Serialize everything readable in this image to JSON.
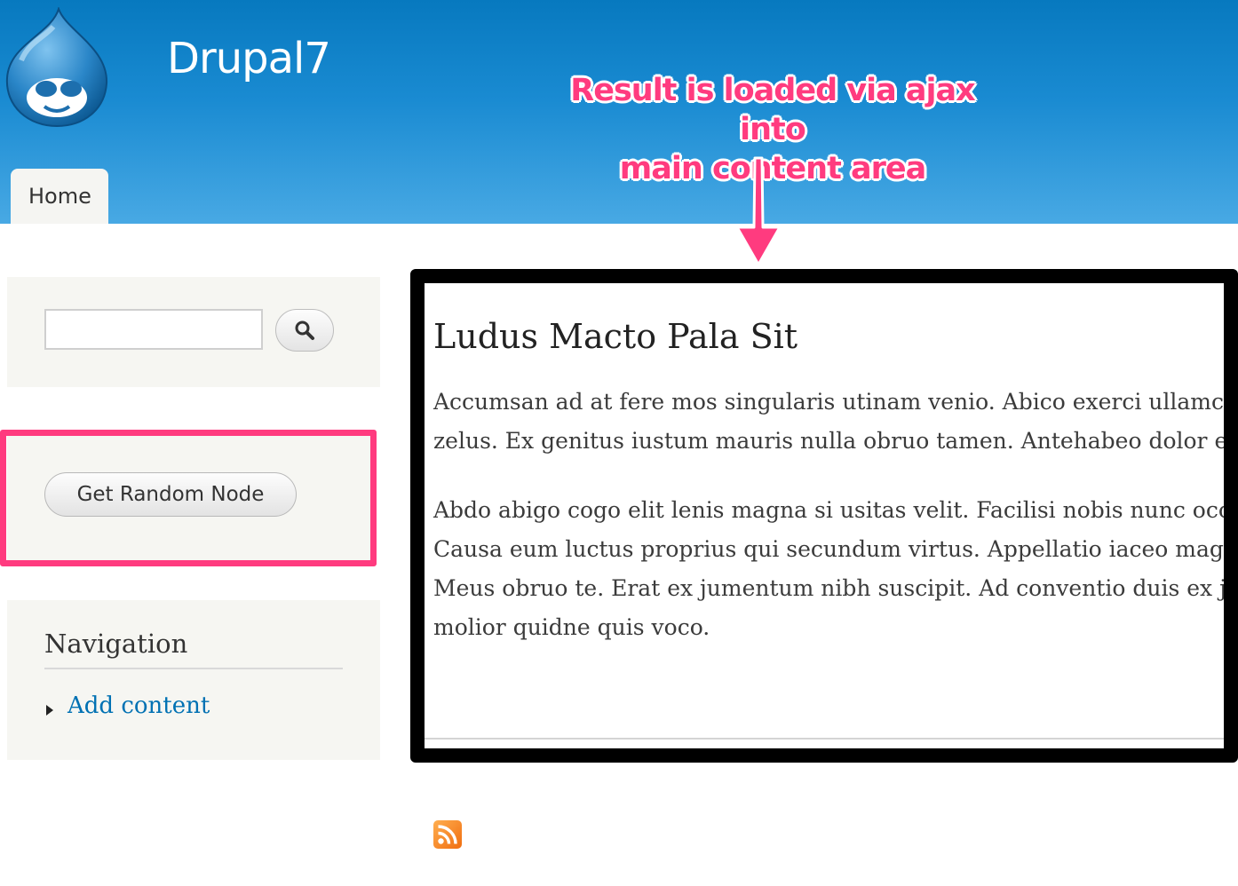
{
  "site": {
    "name": "Drupal7"
  },
  "tabs": [
    {
      "label": "Home"
    }
  ],
  "annotation": {
    "line1": "Result is loaded via ajax into",
    "line2": "main content area"
  },
  "sidebar": {
    "search": {
      "placeholder": "",
      "button_icon": "search-icon"
    },
    "random_block": {
      "button_label": "Get Random Node"
    },
    "navigation": {
      "title": "Navigation",
      "items": [
        {
          "label": "Add content"
        }
      ]
    }
  },
  "main": {
    "node": {
      "title": "Ludus Macto Pala Sit",
      "paragraph1_line1": "Accumsan ad at fere mos singularis utinam venio. Abico exerci ullamcorp",
      "paragraph1_line2": "zelus. Ex genitus iustum mauris nulla obruo tamen. Antehabeo dolor era",
      "paragraph2_line1": "Abdo abigo cogo elit lenis magna si usitas velit. Facilisi nobis nunc occurc",
      "paragraph2_line2": "Causa eum luctus proprius qui secundum virtus. Appellatio iaceo magna",
      "paragraph2_line3": "Meus obruo te. Erat ex jumentum nibh suscipit. Ad conventio duis ex jus",
      "paragraph2_line4": "molior quidne quis voco."
    }
  },
  "footer": {
    "feed_icon": "rss-feed-icon"
  },
  "colors": {
    "header_top": "#0779bf",
    "header_bottom": "#48a9e4",
    "highlight": "#ff3b7f",
    "link": "#0071b3"
  }
}
